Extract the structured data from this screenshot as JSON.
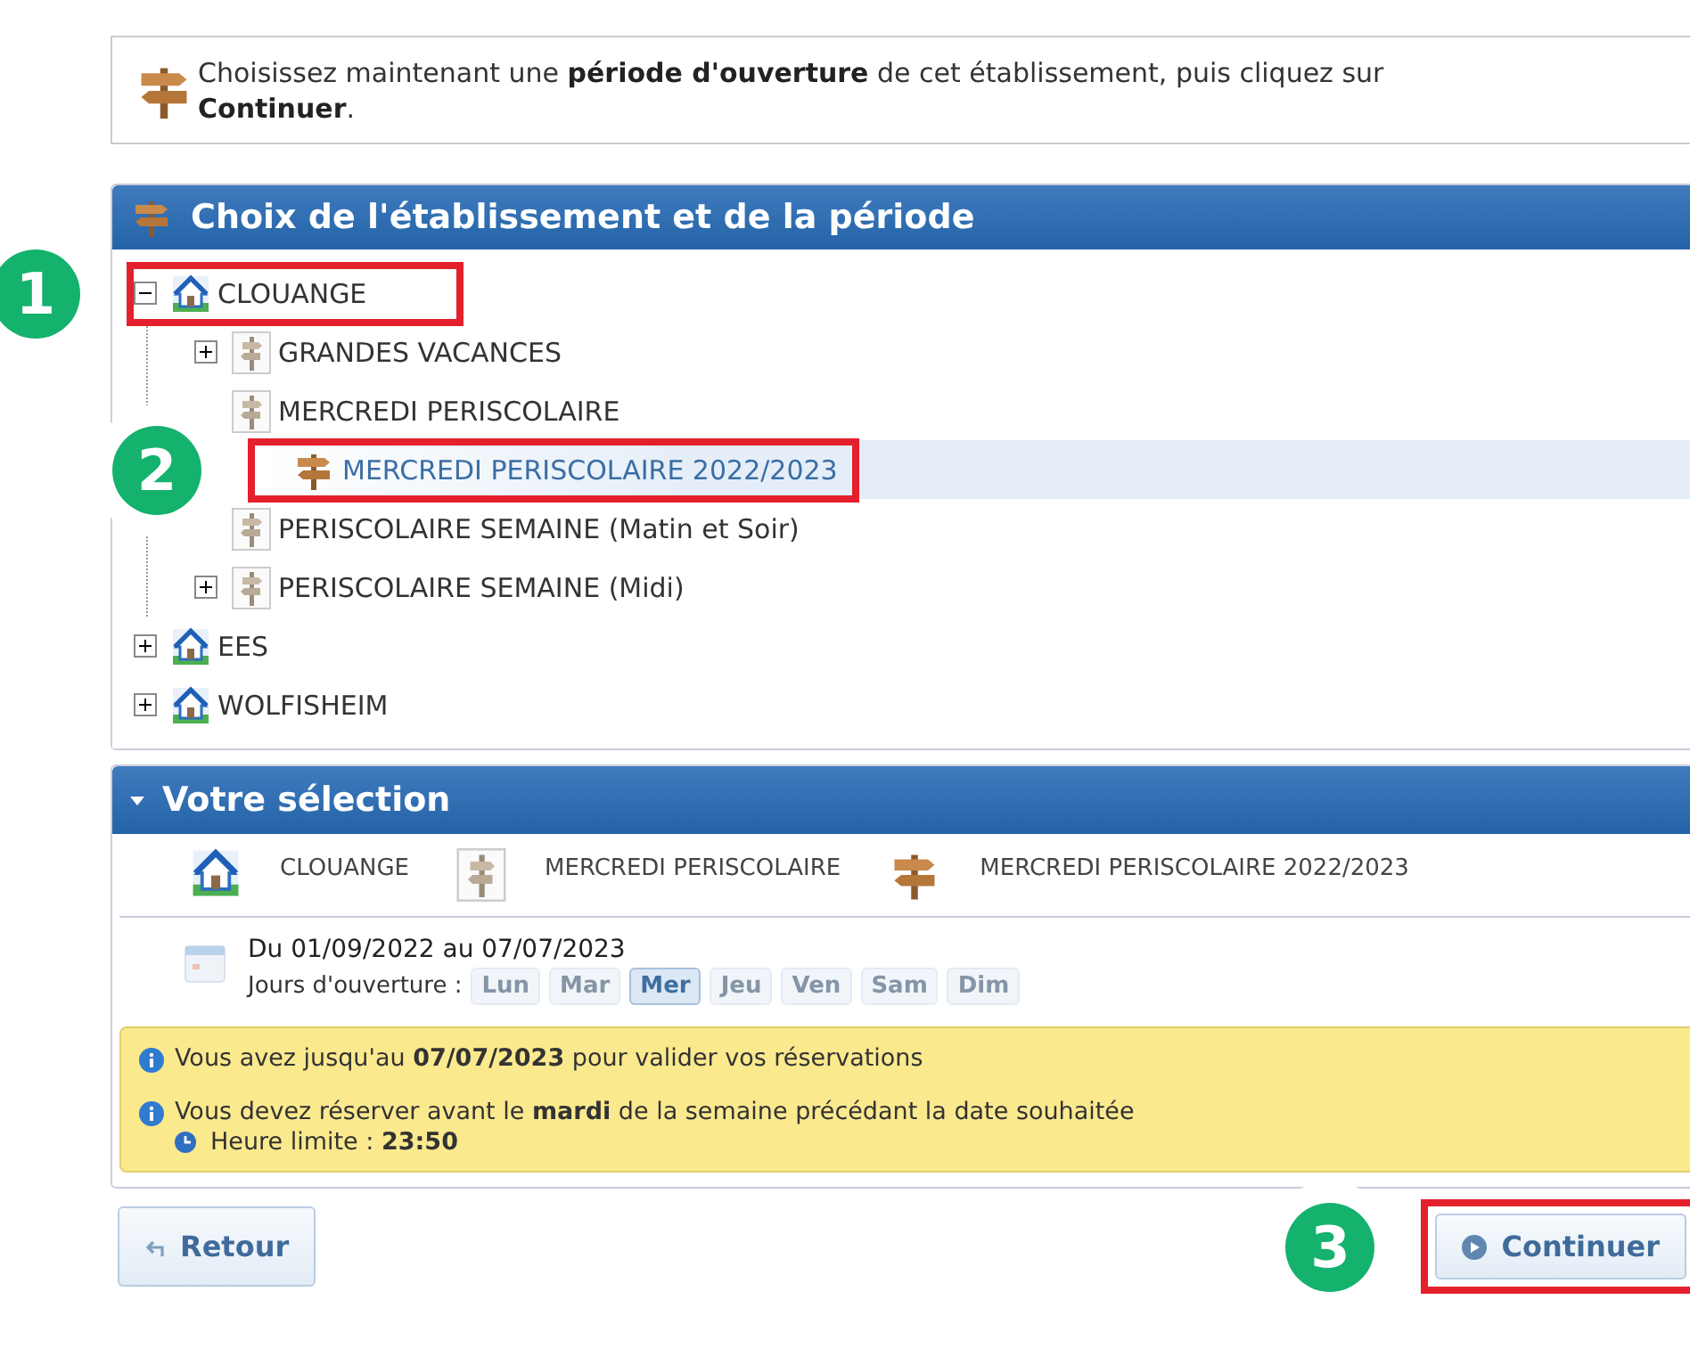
{
  "instruction": "Choisissez maintenant une **période d'ouverture** de cet établissement, puis cliquez sur **Continuer**.",
  "tree_panel": {
    "title": "Choix de l'établissement et de la période",
    "tree": [
      {
        "label": "CLOUANGE",
        "kind": "site",
        "expanded": true,
        "selected": false,
        "highlighted": true,
        "callout": "1",
        "children": [
          {
            "label": "GRANDES VACANCES",
            "kind": "activity",
            "expanded": false,
            "selected": false
          },
          {
            "label": "MERCREDI PERISCOLAIRE",
            "kind": "activity",
            "selected": false,
            "children": [
              {
                "label": "MERCREDI PERISCOLAIRE 2022/2023",
                "kind": "period",
                "selected": true,
                "highlighted": true,
                "callout": "2"
              }
            ]
          },
          {
            "label": "PERISCOLAIRE SEMAINE (Matin et Soir)",
            "kind": "activity",
            "selected": false
          },
          {
            "label": "PERISCOLAIRE SEMAINE (Midi)",
            "kind": "activity",
            "expanded": false,
            "selected": false
          }
        ]
      },
      {
        "label": "EES",
        "kind": "site",
        "expanded": false,
        "selected": false
      },
      {
        "label": "WOLFISHEIM",
        "kind": "site",
        "expanded": false,
        "selected": false
      }
    ]
  },
  "selection_panel": {
    "title": "Votre sélection",
    "items": [
      {
        "kind": "site",
        "label": "CLOUANGE"
      },
      {
        "kind": "activity",
        "label": "MERCREDI PERISCOLAIRE"
      },
      {
        "kind": "period",
        "label": "MERCREDI PERISCOLAIRE 2022/2023"
      }
    ],
    "dates": "Du 01/09/2022 au 07/07/2023",
    "days_label": "Jours d'ouverture :",
    "days": [
      {
        "label": "Lun",
        "selected": false
      },
      {
        "label": "Mar",
        "selected": false
      },
      {
        "label": "Mer",
        "selected": true
      },
      {
        "label": "Jeu",
        "selected": false
      },
      {
        "label": "Ven",
        "selected": false
      },
      {
        "label": "Sam",
        "selected": false
      },
      {
        "label": "Dim",
        "selected": false
      }
    ],
    "notices": [
      {
        "text": "Vous avez jusqu'au **07/07/2023** pour valider vos réservations"
      },
      {
        "text": "Vous devez réserver avant le **mardi** de la semaine précédant la date souhaitée",
        "deadline": "Heure limite : **23:50**"
      }
    ]
  },
  "buttons": [
    {
      "kind": "back",
      "label": "Retour"
    },
    {
      "kind": "next",
      "label": "Continuer",
      "highlighted": true,
      "callout": "3"
    }
  ]
}
